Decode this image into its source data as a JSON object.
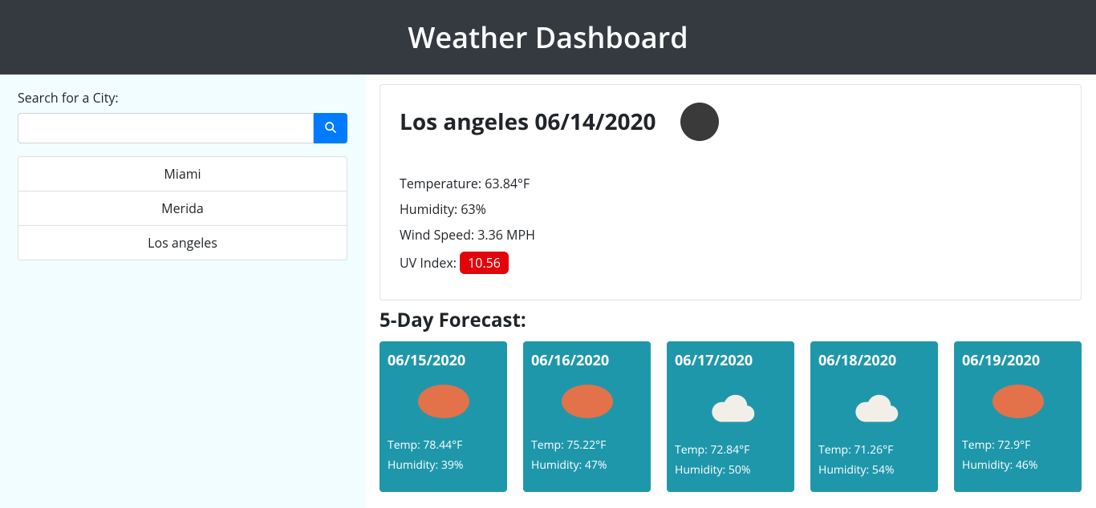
{
  "header": {
    "title": "Weather Dashboard"
  },
  "sidebar": {
    "searchLabel": "Search for a City:",
    "searchValue": "",
    "history": [
      "Miami",
      "Merida",
      "Los angeles"
    ]
  },
  "current": {
    "city": "Los angeles",
    "date": "06/14/2020",
    "tempLabel": "Temperature:",
    "tempValue": "63.84°F",
    "humidityLabel": "Humidity:",
    "humidityValue": "63%",
    "windLabel": "Wind Speed:",
    "windValue": "3.36 MPH",
    "uvLabel": "UV Index:",
    "uvValue": "10.56"
  },
  "forecast": {
    "title": "5-Day Forecast:",
    "days": [
      {
        "date": "06/15/2020",
        "icon": "sun",
        "temp": "Temp: 78.44°F",
        "humidity": "Humidity: 39%"
      },
      {
        "date": "06/16/2020",
        "icon": "sun",
        "temp": "Temp: 75.22°F",
        "humidity": "Humidity: 47%"
      },
      {
        "date": "06/17/2020",
        "icon": "cloud",
        "temp": "Temp: 72.84°F",
        "humidity": "Humidity: 50%"
      },
      {
        "date": "06/18/2020",
        "icon": "cloud",
        "temp": "Temp: 71.26°F",
        "humidity": "Humidity: 54%"
      },
      {
        "date": "06/19/2020",
        "icon": "sun",
        "temp": "Temp: 72.9°F",
        "humidity": "Humidity: 46%"
      }
    ]
  }
}
